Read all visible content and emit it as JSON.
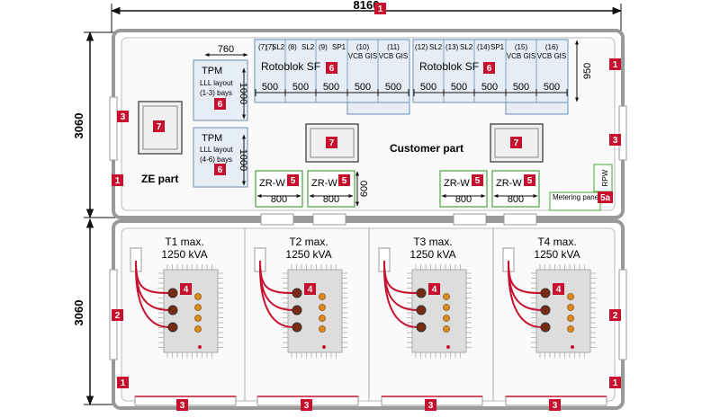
{
  "dimensions": {
    "total_width": "8160",
    "height_top": "3060",
    "height_bottom": "3060",
    "tpm_width": "760",
    "tpm_height": "1000",
    "rotoblok_height": "950",
    "zrw_height": "600"
  },
  "markers": {
    "m1": "1",
    "m2": "2",
    "m3": "3",
    "m4": "4",
    "m5": "5",
    "m5a": "5a",
    "m6": "6",
    "m7": "7"
  },
  "zones": {
    "ze_part": "ZE part",
    "customer_part": "Customer part",
    "metering_panel": "Metering panel",
    "rpw": "RPW"
  },
  "tpm_units": [
    {
      "title": "TPM",
      "layout": "LLL layout",
      "bays": "(1-3) bays"
    },
    {
      "title": "TPM",
      "layout": "LLL layout",
      "bays": "(4-6) bays"
    }
  ],
  "rotoblok_label": "Rotoblok SF",
  "bays_left": [
    {
      "num": "(7)",
      "type": "SL2",
      "width": "500"
    },
    {
      "num": "(8)",
      "type": "SL2",
      "width": "500"
    },
    {
      "num": "(9)",
      "type": "SP1",
      "width": "500"
    },
    {
      "num": "(10)",
      "type": "VCB GIS",
      "width": "500"
    },
    {
      "num": "(11)",
      "type": "VCB GIS",
      "width": "500"
    }
  ],
  "bays_right": [
    {
      "num": "(12)",
      "type": "SL2",
      "width": "500"
    },
    {
      "num": "(13)",
      "type": "SL2",
      "width": "500"
    },
    {
      "num": "(14)",
      "type": "SP1",
      "width": "500"
    },
    {
      "num": "(15)",
      "type": "VCB GIS",
      "width": "500"
    },
    {
      "num": "(16)",
      "type": "VCB GIS",
      "width": "500"
    }
  ],
  "zrw_units": [
    {
      "label": "ZR-W",
      "width": "800"
    },
    {
      "label": "ZR-W",
      "width": "800"
    },
    {
      "label": "ZR-W",
      "width": "800"
    },
    {
      "label": "ZR-W",
      "width": "800"
    }
  ],
  "transformers": [
    {
      "name": "T1  max.",
      "rating": "1250 kVA"
    },
    {
      "name": "T2  max.",
      "rating": "1250 kVA"
    },
    {
      "name": "T3  max.",
      "rating": "1250 kVA"
    },
    {
      "name": "T4  max.",
      "rating": "1250 kVA"
    }
  ],
  "colors": {
    "marker_red": "#c8102e",
    "equipment_fill": "#e6edf5",
    "equipment_stroke": "#6e8fb5",
    "zrw_stroke": "#4aa33e",
    "cable_red": "#c8102e",
    "terminal_orange": "#e08a1e"
  }
}
